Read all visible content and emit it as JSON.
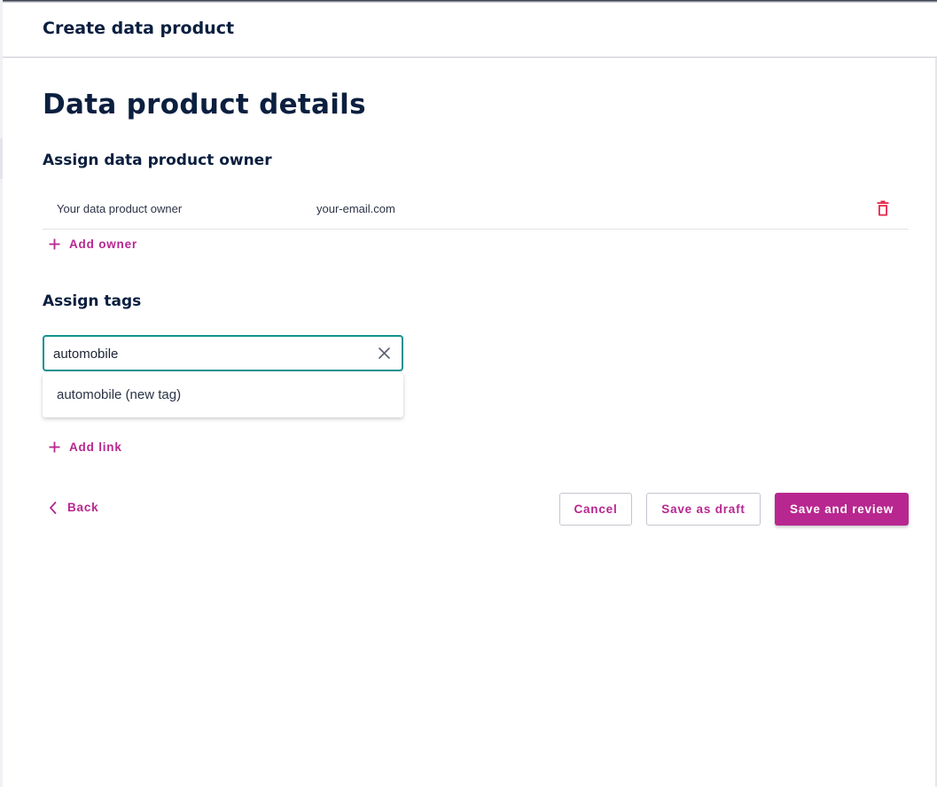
{
  "header": {
    "title": "Create data product"
  },
  "page": {
    "title": "Data product details"
  },
  "owner_section": {
    "title": "Assign data product owner",
    "owners": [
      {
        "name": "Your data product owner",
        "email": "your-email.com"
      }
    ],
    "add_owner_label": "Add owner",
    "delete_icon": "trash-icon"
  },
  "tags_section": {
    "title": "Assign tags",
    "input_value": "automobile",
    "suggestion": "automobile (new tag)",
    "add_link_label": "Add link"
  },
  "footer": {
    "back_label": "Back",
    "cancel_label": "Cancel",
    "draft_label": "Save as draft",
    "submit_label": "Save and review"
  },
  "colors": {
    "accent": "#b8278f",
    "focus": "#12928f",
    "title": "#0b1f3f",
    "delete": "#e5244a"
  }
}
